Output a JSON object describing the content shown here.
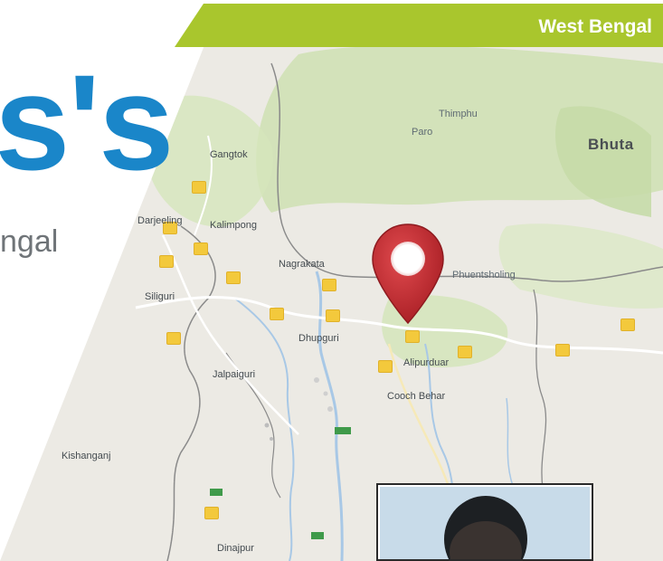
{
  "header": {
    "region_label": "West Bengal"
  },
  "title": {
    "big_text": "s's",
    "subtitle_fragment": "ngal"
  },
  "map": {
    "country_label": "Bhuta",
    "places": [
      {
        "key": "gangtok",
        "name": "Gangtok"
      },
      {
        "key": "thimphu",
        "name": "Thimphu"
      },
      {
        "key": "paro",
        "name": "Paro"
      },
      {
        "key": "darjeeling",
        "name": "Darjeeling"
      },
      {
        "key": "kalimpong",
        "name": "Kalimpong"
      },
      {
        "key": "siliguri",
        "name": "Siliguri"
      },
      {
        "key": "nagrakata",
        "name": "Nagrakata"
      },
      {
        "key": "dhupguri",
        "name": "Dhupguri"
      },
      {
        "key": "jalpaiguri",
        "name": "Jalpaiguri"
      },
      {
        "key": "alipurduar",
        "name": "Alipurduar"
      },
      {
        "key": "coochbehar",
        "name": "Cooch Behar"
      },
      {
        "key": "kishanganj",
        "name": "Kishanganj"
      },
      {
        "key": "dinajpur",
        "name": "Dinajpur"
      },
      {
        "key": "phuentsholing",
        "name": "Phuentsholing"
      }
    ],
    "colors": {
      "land": "#eceae4",
      "forest": "#cfe0b3",
      "water": "#a8c8e6",
      "border": "#8a8a8a",
      "road_badge": "#f3c93c",
      "pin": "#c1272d"
    }
  },
  "colors": {
    "header_green": "#a9c62d",
    "title_blue": "#1a86c9",
    "subtitle_gray": "#6f7478"
  },
  "photo": {
    "icon": "person-photo"
  }
}
